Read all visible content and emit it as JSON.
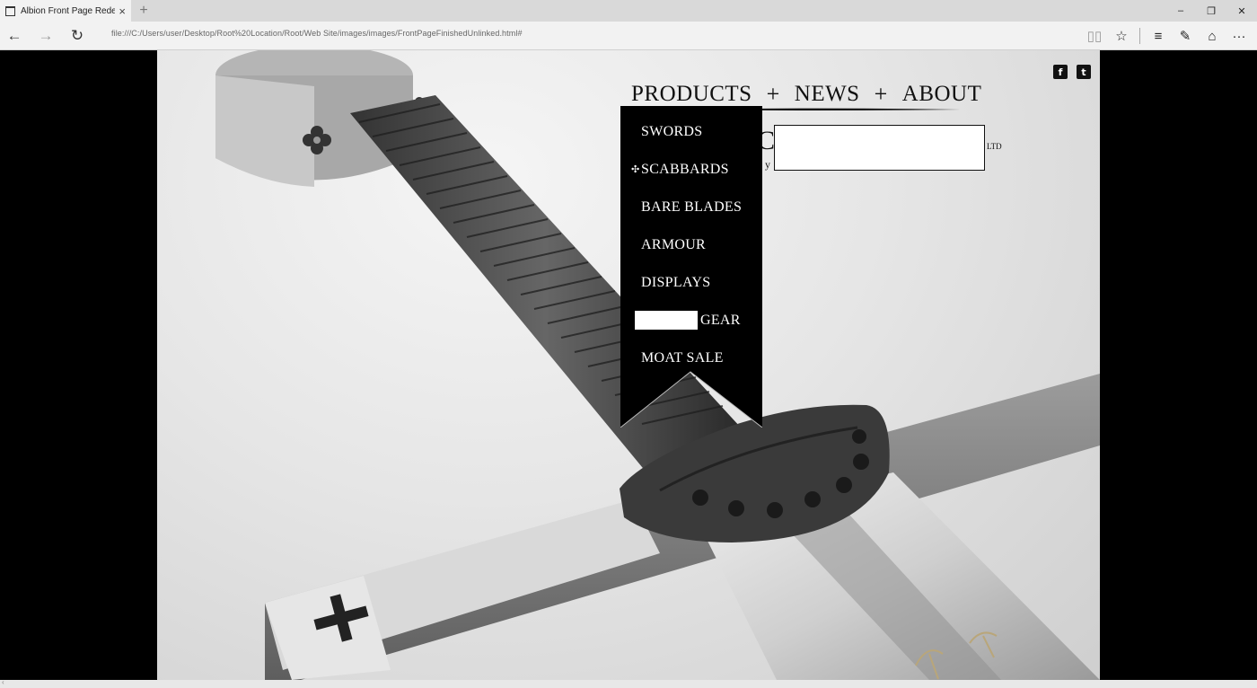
{
  "browser": {
    "tab_title": "Albion Front Page Rede",
    "tab_close": "×",
    "new_tab": "+",
    "url": "file:///C:/Users/user/Desktop/Root%20Location/Root/Web Site/images/images/FrontPageFinishedUnlinked.html#",
    "window_controls": {
      "minimize": "–",
      "maximize": "❐",
      "close": "✕"
    },
    "nav": {
      "back": "←",
      "forward": "→",
      "refresh": "↻"
    },
    "toolbar": {
      "reading": "▯▯",
      "favorite": "☆",
      "hub": "≡",
      "notes": "✎",
      "share": "⌂",
      "more": "···"
    }
  },
  "site": {
    "social": {
      "facebook": "f",
      "twitter": "t"
    },
    "nav": {
      "items": [
        "PRODUCTS",
        "NEWS",
        "ABOUT"
      ],
      "separator": "+"
    },
    "logo": {
      "partial_left": "C",
      "small_left": "y",
      "small_right": "LTD"
    },
    "dropdown": {
      "items": [
        "SWORDS",
        "SCABBARDS",
        "BARE BLADES",
        "ARMOUR",
        "DISPLAYS",
        "GEAR",
        "MOAT SALE"
      ],
      "active_index": 1,
      "pointer": "✣"
    }
  }
}
